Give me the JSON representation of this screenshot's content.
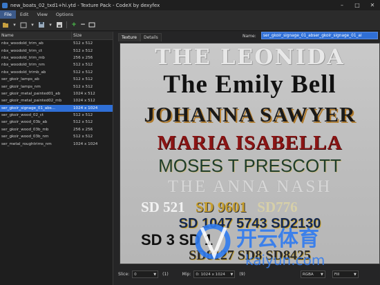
{
  "window": {
    "title": "new_boats_02_txd1+hi.ytd - Texture Pack - CodeX by dexyfex",
    "controls": [
      "–",
      "□",
      "✕"
    ]
  },
  "menu": [
    "File",
    "Edit",
    "View",
    "Options"
  ],
  "list": {
    "headers": {
      "name": "Name",
      "size": "Size"
    },
    "rows": [
      {
        "name": "nbx_woodold_trim_ab",
        "size": "512 x 512"
      },
      {
        "name": "nbx_woodold_trim_ct",
        "size": "512 x 512"
      },
      {
        "name": "nbx_woodold_trim_mb",
        "size": "256 x 256"
      },
      {
        "name": "nbx_woodold_trim_nm",
        "size": "512 x 512"
      },
      {
        "name": "nbx_woodold_trimb_ab",
        "size": "512 x 512"
      },
      {
        "name": "ser_gkoir_lamps_ab",
        "size": "512 x 512"
      },
      {
        "name": "ser_gkoir_lamps_nm",
        "size": "512 x 512"
      },
      {
        "name": "ser_gkoir_metal_painted01_ab",
        "size": "1024 x 512"
      },
      {
        "name": "ser_gkoir_metal_painted02_mb",
        "size": "1024 x 512"
      },
      {
        "name": "ser_gkoir_signage_01_abs...",
        "size": "1024 x 1024"
      },
      {
        "name": "ser_gkoir_wood_02_ct",
        "size": "512 x 512"
      },
      {
        "name": "ser_gkoir_wood_03b_ab",
        "size": "512 x 512"
      },
      {
        "name": "ser_gkoir_wood_03b_mb",
        "size": "256 x 256"
      },
      {
        "name": "ser_gkoir_wood_03b_nm",
        "size": "512 x 512"
      },
      {
        "name": "ser_metal_roughtrims_nm",
        "size": "1024 x 1024"
      }
    ],
    "selected_index": 9
  },
  "tabs": [
    "Texture",
    "Details"
  ],
  "name_label": "Name:",
  "name_value": "ser_gkoir_signage_01_abser_gkoir_signage_01_al",
  "texture_text": {
    "line1": "THE LEONIDA",
    "line2": "The Emily Bell",
    "line3": "JOHANNA SAWYER",
    "line4": "MARIA ISABELLA",
    "line5": "MOSES T PRESCOTT",
    "line6": "THE ANNA NASH",
    "sd_row1": [
      "SD 521",
      "SD 9601",
      "SD776"
    ],
    "sd_row2": "SD 1047  5743  SD2130",
    "sd_row3": "SD 3    SD 1",
    "sd_row4": "SD8127  SD8  SD8425"
  },
  "bottom": {
    "slice_label": "Slice:",
    "slice_value": "0",
    "slice_count": "(1)",
    "mip_label": "Mip:",
    "mip_value": "0: 1024 x 1024",
    "mip_count": "(9)",
    "format_value": "RGBA",
    "fit_value": "Fill"
  },
  "watermark": {
    "brand": "开云体育",
    "url": "kaiyun.com"
  }
}
